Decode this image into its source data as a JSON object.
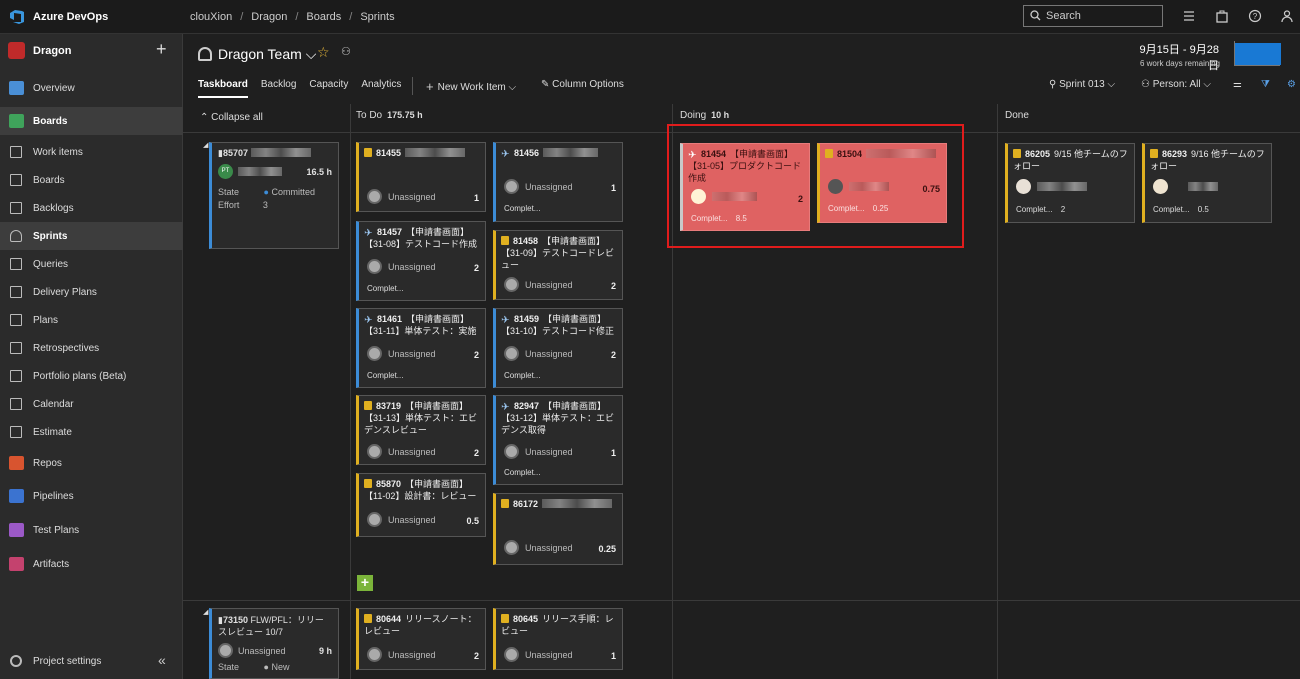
{
  "app": {
    "brand": "Azure DevOps"
  },
  "breadcrumb": [
    "clouXion",
    "Dragon",
    "Boards",
    "Sprints"
  ],
  "search": {
    "label": "Search"
  },
  "sidebar": {
    "project": "Dragon",
    "items": [
      {
        "label": "Overview",
        "color": "#4a8fd6"
      },
      {
        "label": "Boards",
        "color": "#3fa35b"
      },
      {
        "label": "Work items"
      },
      {
        "label": "Boards"
      },
      {
        "label": "Backlogs"
      },
      {
        "label": "Sprints"
      },
      {
        "label": "Queries"
      },
      {
        "label": "Delivery Plans"
      },
      {
        "label": "Plans"
      },
      {
        "label": "Retrospectives"
      },
      {
        "label": "Portfolio plans (Beta)"
      },
      {
        "label": "Calendar"
      },
      {
        "label": "Estimate"
      },
      {
        "label": "Repos",
        "color": "#d8542f"
      },
      {
        "label": "Pipelines",
        "color": "#3b73d0"
      },
      {
        "label": "Test Plans",
        "color": "#9b59c7"
      },
      {
        "label": "Artifacts",
        "color": "#c4426e"
      }
    ],
    "settings": "Project settings"
  },
  "header": {
    "team": "Dragon Team",
    "dates": "9月15日 - 9月28日",
    "remaining": "6 work days remaining",
    "tabs": [
      "Taskboard",
      "Backlog",
      "Capacity",
      "Analytics"
    ],
    "new_work_item": "New Work Item",
    "column_options": "Column Options",
    "sprint": "Sprint 013",
    "person": "Person: All"
  },
  "board": {
    "collapse_all": "Collapse all",
    "columns": [
      {
        "name": "To Do",
        "hours": "175.75 h"
      },
      {
        "name": "Doing",
        "hours": "10 h"
      },
      {
        "name": "Done",
        "hours": ""
      }
    ],
    "pbi1": {
      "id": "85707",
      "hours": "16.5 h",
      "state_label": "State",
      "state": "Committed",
      "effort_label": "Effort",
      "effort": "3",
      "initials": "PT"
    },
    "pbi2": {
      "id": "73150",
      "title": "FLW/PFL：リリースレビュー 10/7",
      "assignee": "Unassigned",
      "hours": "9 h",
      "state_label": "State",
      "state": "New"
    },
    "cards": {
      "c81455": {
        "id": "81455",
        "title": "",
        "assignee": "Unassigned",
        "rem": "1"
      },
      "c81456": {
        "id": "81456",
        "title": "",
        "assignee": "Unassigned",
        "rem": "1",
        "comp": "Complet..."
      },
      "c81457": {
        "id": "81457",
        "title": "【申請書画面】【31-08】テストコード作成",
        "assignee": "Unassigned",
        "rem": "2",
        "comp": "Complet..."
      },
      "c81458": {
        "id": "81458",
        "title": "【申請書画面】【31-09】テストコードレビュー",
        "assignee": "Unassigned",
        "rem": "2"
      },
      "c81461": {
        "id": "81461",
        "title": "【申請書画面】【31-11】単体テスト：実施",
        "assignee": "Unassigned",
        "rem": "2",
        "comp": "Complet..."
      },
      "c81459": {
        "id": "81459",
        "title": "【申請書画面】【31-10】テストコード修正",
        "assignee": "Unassigned",
        "rem": "2",
        "comp": "Complet..."
      },
      "c83719": {
        "id": "83719",
        "title": "【申請書画面】【31-13】単体テスト：エビデンスレビュー",
        "assignee": "Unassigned",
        "rem": "2"
      },
      "c82947": {
        "id": "82947",
        "title": "【申請書画面】【31-12】単体テスト：エビデンス取得",
        "assignee": "Unassigned",
        "rem": "1",
        "comp": "Complet..."
      },
      "c85870": {
        "id": "85870",
        "title": "【申請書画面】【11-02】設計書：レビュー",
        "assignee": "Unassigned",
        "rem": "0.5"
      },
      "c86172": {
        "id": "86172",
        "title": "",
        "assignee": "Unassigned",
        "rem": "0.25"
      },
      "c81454": {
        "id": "81454",
        "title": "【申請書画面】【31-05】プロダクトコード作成",
        "rem": "2",
        "comp": "Complet...",
        "comp_val": "8.5"
      },
      "c81504": {
        "id": "81504",
        "title": "",
        "rem": "0.75",
        "comp": "Complet...",
        "comp_val": "0.25"
      },
      "c86205": {
        "id": "86205",
        "title": "9/15 他チームのフォロー",
        "comp": "Complet...",
        "comp_val": "2"
      },
      "c86293": {
        "id": "86293",
        "title": "9/16 他チームのフォロー",
        "comp": "Complet...",
        "comp_val": "0.5"
      },
      "c80644": {
        "id": "80644",
        "title": "リリースノート：レビュー",
        "assignee": "Unassigned",
        "rem": "2"
      },
      "c80645": {
        "id": "80645",
        "title": "リリース手順：レビュー",
        "assignee": "Unassigned",
        "rem": "1"
      }
    }
  }
}
